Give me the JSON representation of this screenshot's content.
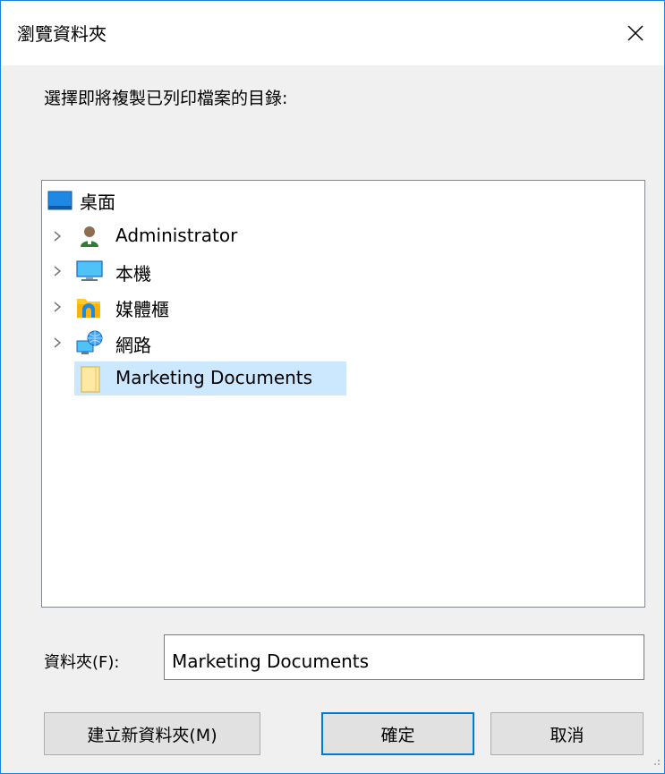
{
  "window": {
    "title": "瀏覽資料夾",
    "close_glyph": "✕"
  },
  "prompt": "選擇即將複製已列印檔案的目錄:",
  "tree": {
    "items": [
      {
        "label": "桌面",
        "icon": "desktop-icon",
        "expandable": false
      },
      {
        "label": "Administrator",
        "icon": "user-icon",
        "expandable": true
      },
      {
        "label": "本機",
        "icon": "computer-icon",
        "expandable": true
      },
      {
        "label": "媒體櫃",
        "icon": "libraries-icon",
        "expandable": true
      },
      {
        "label": "網路",
        "icon": "network-icon",
        "expandable": true
      },
      {
        "label": "Marketing Documents",
        "icon": "folder-icon",
        "expandable": false,
        "selected": true
      }
    ]
  },
  "folder_field": {
    "label": "資料夾(F):",
    "value": "Marketing Documents"
  },
  "buttons": {
    "new_folder": "建立新資料夾(M)",
    "ok": "確定",
    "cancel": "取消"
  },
  "colors": {
    "accent": "#0078d7",
    "selection": "#cce8ff",
    "window_border": "#1883d7"
  }
}
